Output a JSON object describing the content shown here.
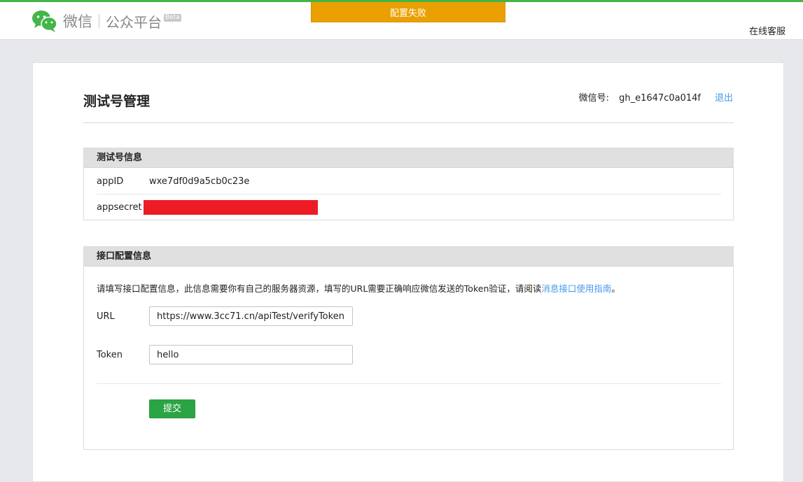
{
  "header": {
    "logo_wechat": "微信",
    "logo_platform": "公众平台",
    "logo_beta": "Beta",
    "toast": "配置失败",
    "support_link": "在线客服"
  },
  "page": {
    "title": "测试号管理",
    "account_label": "微信号:",
    "account_value": "gh_e1647c0a014f",
    "logout": "退出"
  },
  "test_account": {
    "heading": "测试号信息",
    "appid_label": "appID",
    "appid_value": "wxe7df0d9a5cb0c23e",
    "appsecret_label": "appsecret"
  },
  "interface": {
    "heading": "接口配置信息",
    "description": "请填写接口配置信息，此信息需要你有自己的服务器资源，填写的URL需要正确响应微信发送的Token验证，请阅读",
    "guide_link": "消息接口使用指南",
    "description_end": "。",
    "url_label": "URL",
    "url_value": "https://www.3cc71.cn/apiTest/verifyToken",
    "token_label": "Token",
    "token_value": "hello",
    "submit": "提交"
  },
  "colors": {
    "brand_green": "#44b549",
    "toast_orange": "#eaa000",
    "link_blue": "#459ae9",
    "submit_green": "#2aa444",
    "redaction_red": "#ed1c24"
  },
  "icons": {
    "logo": "wechat-logo-icon"
  }
}
